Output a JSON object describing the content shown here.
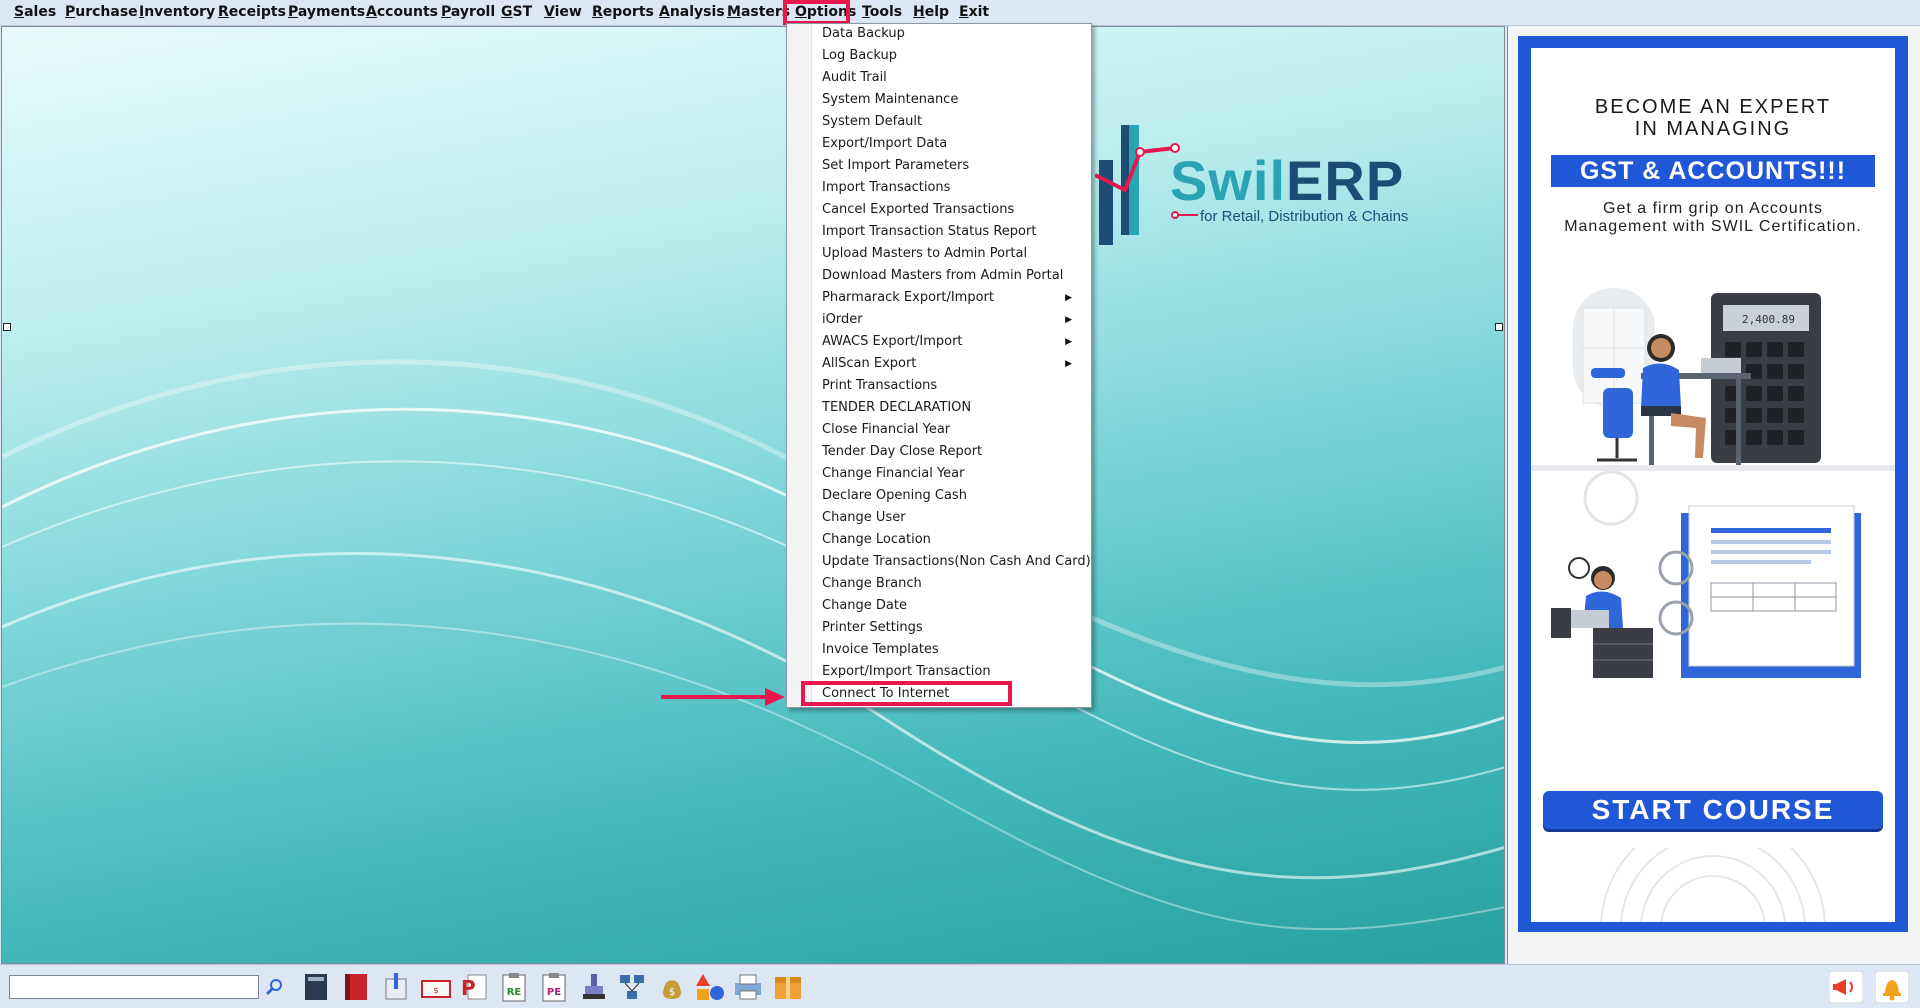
{
  "menubar": {
    "items": [
      {
        "u": "S",
        "rest": "ales"
      },
      {
        "u": "P",
        "rest": "urchase"
      },
      {
        "u": "I",
        "rest": "nventory"
      },
      {
        "u": "R",
        "rest": "eceipts"
      },
      {
        "u": "P",
        "rest": "ayments"
      },
      {
        "u": "A",
        "rest": "ccounts"
      },
      {
        "u": "P",
        "rest": "ayroll"
      },
      {
        "u": "G",
        "rest": "ST"
      },
      {
        "u": "V",
        "rest": "iew"
      },
      {
        "u": "R",
        "rest": "eports"
      },
      {
        "u": "A",
        "rest": "nalysis"
      },
      {
        "u": "M",
        "rest": "asters"
      },
      {
        "u": "O",
        "rest": "ptions"
      },
      {
        "u": "T",
        "rest": "ools"
      },
      {
        "u": "H",
        "rest": "elp"
      },
      {
        "u": "E",
        "rest": "xit"
      }
    ],
    "active": "Options"
  },
  "options_menu": {
    "items": [
      {
        "label": "Data Backup",
        "submenu": false
      },
      {
        "label": "Log Backup",
        "submenu": false
      },
      {
        "label": "Audit Trail",
        "submenu": false
      },
      {
        "label": "System Maintenance",
        "submenu": false
      },
      {
        "label": "System Default",
        "submenu": false
      },
      {
        "label": "Export/Import Data",
        "submenu": false
      },
      {
        "label": "Set Import Parameters",
        "submenu": false
      },
      {
        "label": "Import Transactions",
        "submenu": false
      },
      {
        "label": "Cancel Exported Transactions",
        "submenu": false
      },
      {
        "label": "Import Transaction Status Report",
        "submenu": false
      },
      {
        "label": "Upload Masters to Admin Portal",
        "submenu": false
      },
      {
        "label": "Download Masters from Admin Portal",
        "submenu": false
      },
      {
        "label": "Pharmarack Export/Import",
        "submenu": true
      },
      {
        "label": "iOrder",
        "submenu": true
      },
      {
        "label": "AWACS Export/Import",
        "submenu": true
      },
      {
        "label": "AllScan Export",
        "submenu": true
      },
      {
        "label": "Print Transactions",
        "submenu": false
      },
      {
        "label": "TENDER DECLARATION",
        "submenu": false
      },
      {
        "label": "Close Financial Year",
        "submenu": false
      },
      {
        "label": "Tender Day Close Report",
        "submenu": false
      },
      {
        "label": "Change Financial Year",
        "submenu": false
      },
      {
        "label": "Declare Opening Cash",
        "submenu": false
      },
      {
        "label": "Change User",
        "submenu": false
      },
      {
        "label": "Change Location",
        "submenu": false
      },
      {
        "label": "Update Transactions(Non Cash And Card)",
        "submenu": false
      },
      {
        "label": "Change Branch",
        "submenu": false
      },
      {
        "label": "Change Date",
        "submenu": false
      },
      {
        "label": "Printer Settings",
        "submenu": false
      },
      {
        "label": "Invoice Templates",
        "submenu": false
      },
      {
        "label": "Export/Import Transaction",
        "submenu": false
      },
      {
        "label": "Connect To Internet",
        "submenu": false
      }
    ],
    "highlighted": "Connect To Internet"
  },
  "logo": {
    "brand_a": "Swil",
    "brand_b": "ERP",
    "tagline": "for Retail, Distribution & Chains"
  },
  "ad": {
    "title_line1": "BECOME AN EXPERT",
    "title_line2": "IN MANAGING",
    "highlight": "GST & ACCOUNTS!!!",
    "sub_line1": "Get a firm grip on Accounts",
    "sub_line2": "Management with SWIL Certification.",
    "calculator_value": "2,400.89",
    "button": "START COURSE"
  },
  "toolbar": {
    "search_value": "",
    "icons": [
      "ledger-book-icon",
      "red-book-icon",
      "pen-doc-icon",
      "cash-book-icon",
      "pdf-document-icon",
      "re-clipboard-icon",
      "pe-clipboard-icon",
      "stamp-icon",
      "network-icon",
      "money-bag-icon",
      "shapes-icon",
      "printer-icon",
      "package-box-icon"
    ],
    "right_icons": [
      "announcement-icon",
      "notification-bell-icon"
    ]
  },
  "colors": {
    "accent_red": "#e8174e",
    "brand_teal": "#2aa3b3",
    "brand_navy": "#1c4d75",
    "ad_blue": "#1f57d6"
  }
}
